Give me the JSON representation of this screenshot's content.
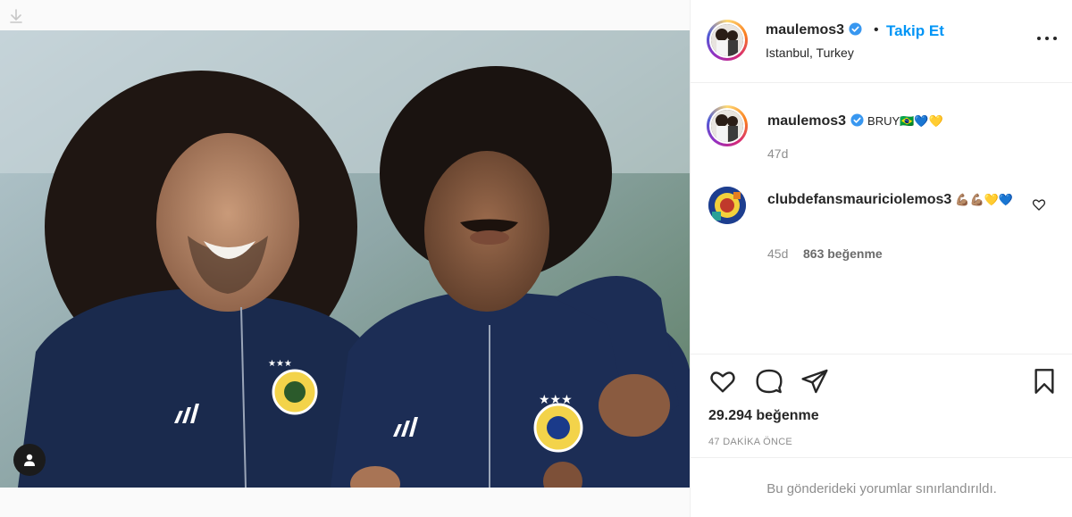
{
  "post": {
    "username": "maulemos3",
    "follow_label": "Takip Et",
    "separator": "•",
    "location": "Istanbul, Turkey"
  },
  "comments": [
    {
      "username": "maulemos3",
      "text": "BRUY🇧🇷💙💛",
      "time": "47d"
    },
    {
      "username": "clubdefansmauriciolemos3",
      "text": "💪🏽💪🏽💛💙",
      "time": "45d",
      "likes": "863 beğenme"
    }
  ],
  "stats": {
    "likes": "29.294 beğenme",
    "time_ago": "47 DAKİKA ÖNCE"
  },
  "footer": {
    "restricted_message": "Bu gönderideki yorumlar sınırlandırıldı."
  },
  "icons": {
    "download": "download-icon",
    "tag": "user-tag-icon",
    "verified": "verified-badge-icon",
    "more": "more-options-icon",
    "like": "heart-icon",
    "comment": "comment-icon",
    "share": "share-icon",
    "save": "bookmark-icon"
  },
  "colors": {
    "accent": "#0095f6",
    "verified": "#3897f0",
    "muted": "#8e8e8e",
    "text": "#262626",
    "border": "#efefef"
  }
}
